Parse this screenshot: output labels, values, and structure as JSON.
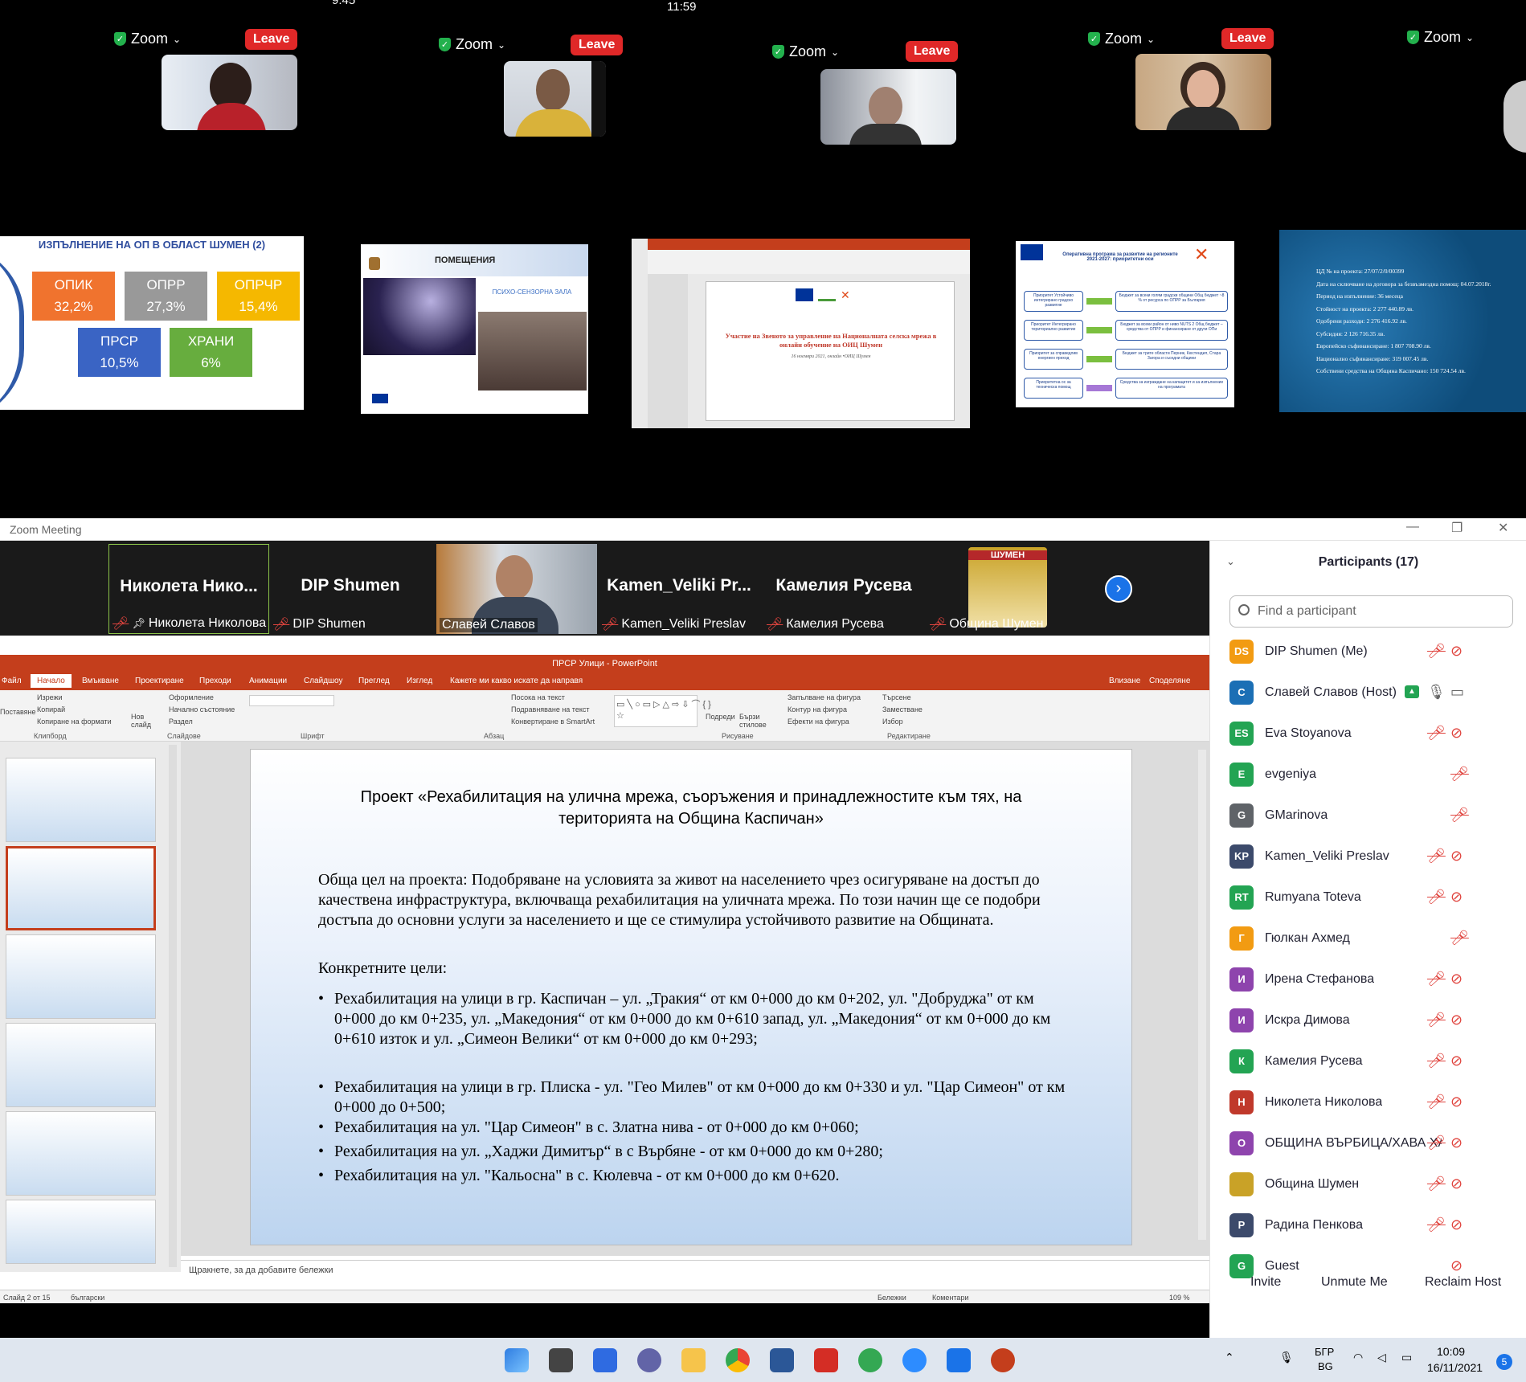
{
  "top": {
    "phone1": {
      "time": "9:45"
    },
    "phone2": {
      "time": "11:59"
    },
    "zoom_label": "Zoom",
    "leave_label": "Leave",
    "slides": {
      "s1": {
        "title": "ИЗПЪЛНЕНИЕ НА ОП В ОБЛАСТ ШУМЕН (2)",
        "pills": [
          {
            "name": "ОПИК",
            "value": "32,2%",
            "color": "#f0732e"
          },
          {
            "name": "ОПРР",
            "value": "27,3%",
            "color": "#999999"
          },
          {
            "name": "ОПРЧР",
            "value": "15,4%",
            "color": "#f5b800"
          },
          {
            "name": "ПРСР",
            "value": "10,5%",
            "color": "#3a64c4"
          },
          {
            "name": "ХРАНИ",
            "value": "6%",
            "color": "#67ad3e"
          }
        ]
      },
      "s2": {
        "title": "ПОМЕЩЕНИЯ",
        "caption": "ПСИХО-СЕНЗОРНА ЗАЛА"
      },
      "s3": {
        "title": "Участие на Звеното за управление на Националната селска мрежа в онлайн обучение на ОИЦ Шумен",
        "subtitle": "16 ноември 2021, онлайн •ОИЦ Шумен"
      },
      "s4": {
        "title": "Оперативна програма за развитие на регионите 2021-2027: приоритетни оси",
        "rows": [
          {
            "left": "Приоритет Устойчиво интегрирано градско развитие",
            "right": "Бюджет за всеки голям градски общини Общ бюджет ~8 % от ресурса по ОПРР за България"
          },
          {
            "left": "Приоритет Интегрирано териториално развитие",
            "right": "Бюджет за всеки район от ниво NUTS 2 Общ бюджет – средства от ОПРР и финансиране от други ОПи"
          },
          {
            "left": "Приоритет за справедлив енергиен преход",
            "right": "Бюджет за трите области Перник, Кюстендил, Стара Загора и съседни общини"
          },
          {
            "left": "Приоритетна ос за техническа помощ",
            "right": "Средства за изграждане на капацитет и за изпълнение на програмата"
          }
        ]
      },
      "s5": {
        "lines": [
          "ЦД № на проекта: 27/07/2/0/00399",
          "Дата на сключване на договора за безвъзмездна помощ: 04.07.2018г.",
          "Период на изпълнение: 36 месеца",
          "Стойност на проекта: 2 277 440.89 лв.",
          "Одобрени разходи: 2 276 416.92 лв.",
          "Субсидия: 2 126 716.35 лв.",
          "Европейско съфинансиране: 1 807 708.90 лв.",
          "Национално съфинансиране: 319 007.45 лв.",
          "Собствени средства на Община Каспичано: 150 724.54 лв."
        ]
      }
    }
  },
  "window": {
    "title": "Zoom Meeting",
    "strip": [
      {
        "big": "Николета Нико...",
        "label": "Николета Николова",
        "pinned": true
      },
      {
        "big": "DIP Shumen",
        "label": "DIP Shumen"
      },
      {
        "big": "",
        "label": "Славей Славов",
        "video": true
      },
      {
        "big": "Kamen_Veliki Pr...",
        "label": "Kamen_Veliki Preslav"
      },
      {
        "big": "Камелия Русева",
        "label": "Камелия Русева"
      },
      {
        "big": "",
        "label": "Община Шумен",
        "crest": true
      }
    ],
    "crest_text": "ШУМЕН"
  },
  "panel": {
    "title": "Participants (17)",
    "search_placeholder": "Find a participant",
    "participants": [
      {
        "initials": "DS",
        "name": "DIP Shumen (Me)",
        "color": "#f29b12"
      },
      {
        "initials": "С",
        "name": "Славей Славов (Host)",
        "color": "#1b6fb5"
      },
      {
        "initials": "ES",
        "name": "Eva Stoyanova",
        "color": "#23a453"
      },
      {
        "initials": "E",
        "name": "evgeniya",
        "color": "#23a453"
      },
      {
        "initials": "G",
        "name": "GMarinova",
        "color": "#5f6368"
      },
      {
        "initials": "KP",
        "name": "Kamen_Veliki Preslav",
        "color": "#3c4a6b"
      },
      {
        "initials": "RT",
        "name": "Rumyana Toteva",
        "color": "#23a453"
      },
      {
        "initials": "Г",
        "name": "Гюлкан Ахмед",
        "color": "#f29b12"
      },
      {
        "initials": "И",
        "name": "Ирена Стефанова",
        "color": "#8e44ad"
      },
      {
        "initials": "И",
        "name": "Искра Димова",
        "color": "#8e44ad"
      },
      {
        "initials": "К",
        "name": "Камелия Русева",
        "color": "#23a453"
      },
      {
        "initials": "Н",
        "name": "Николета Николова",
        "color": "#c0392b"
      },
      {
        "initials": "О",
        "name": "ОБЩИНА ВЪРБИЦА/ХАВА ХАСАНО...",
        "color": "#8e44ad"
      },
      {
        "initials": "",
        "name": "Община Шумен",
        "color": "#c9a227"
      },
      {
        "initials": "Р",
        "name": "Радина Пенкова",
        "color": "#3c4a6b"
      },
      {
        "initials": "G",
        "name": "Guest",
        "color": "#23a453"
      }
    ],
    "footer": {
      "invite": "Invite",
      "unmute": "Unmute Me",
      "reclaim": "Reclaim Host"
    }
  },
  "ppt": {
    "title": "ПРСР Улици - PowerPoint",
    "tabs": [
      "Файл",
      "Начало",
      "Вмъкване",
      "Проектиране",
      "Преходи",
      "Анимации",
      "Слайдшоу",
      "Преглед",
      "Изглед"
    ],
    "tell_me": "Кажете ми какво искате да направя",
    "sign_in": "Влизане",
    "share": "Споделяне",
    "ribbon": {
      "paste": "Поставяне",
      "cut": "Изрежи",
      "copy": "Копирай",
      "format_painter": "Копиране на формати",
      "new_slide": "Нов слайд",
      "layout": "Оформление",
      "reset": "Начално състояние",
      "section": "Раздел",
      "text_direction": "Посока на текст",
      "align_text": "Подравняване на текст",
      "smartart": "Конвертиране в SmartArt",
      "arrange": "Подреди",
      "quick_styles": "Бързи стилове",
      "shape_fill": "Запълване на фигура",
      "shape_outline": "Контур на фигура",
      "shape_effects": "Ефекти на фигура",
      "find": "Търсене",
      "replace": "Заместване",
      "select": "Избор"
    },
    "groups": [
      "Клипборд",
      "Слайдове",
      "Шрифт",
      "Абзац",
      "Рисуване",
      "Редактиране"
    ],
    "slide": {
      "title_line1": "Проект «Рехабилитация на улична мрежа, съоръжения и принадлежностите към тях, на",
      "title_line2": "територията на Община Каспичан»",
      "goal": "Обща цел на проекта: Подобряване на условията за живот на населението чрез осигуряване на достъп до качествена инфраструктура, включваща рехабилитация на уличната мрежа. По този начин ще се подобри достъпа до основни услуги за населението и ще се стимулира устойчивото развитие на Общината.",
      "specific": "Конкретните цели:",
      "bullets": [
        " Рехабилитация на улици в гр. Каспичан – ул. „Тракия“ от км 0+000 до км 0+202, ул. \"Добруджа\" от км 0+000 до км 0+235, ул. „Македония“ от км 0+000 до км 0+610 запад, ул. „Македония“ от км 0+000 до км 0+610 изток и ул. „Симеон Велики“ от км 0+000 до км 0+293;",
        "Рехабилитация на улици в гр. Плиска - ул. \"Гео Милев\" от км 0+000 до км 0+330 и ул. \"Цар Симеон\" от км 0+000 до 0+500;",
        "Рехабилитация на ул. \"Цар Симеон\" в с. Златна нива - от 0+000 до км 0+060;",
        "Рехабилитация на ул. „Хаджи Димитър“ в с Върбяне - от км 0+000 до км 0+280;",
        "Рехабилитация на ул. \"Кальосна\" в с. Кюлевча - от км 0+000 до км 0+620."
      ]
    },
    "notes_placeholder": "Щракнете, за да добавите бележки",
    "status": {
      "slide_of": "Слайд 2 от 15",
      "language": "български",
      "notes": "Бележки",
      "comments": "Коментари",
      "zoom": "109 %"
    }
  },
  "taskbar": {
    "lang_top": "БГР",
    "lang_bottom": "BG",
    "time": "10:09",
    "date": "16/11/2021",
    "badge": "5"
  }
}
